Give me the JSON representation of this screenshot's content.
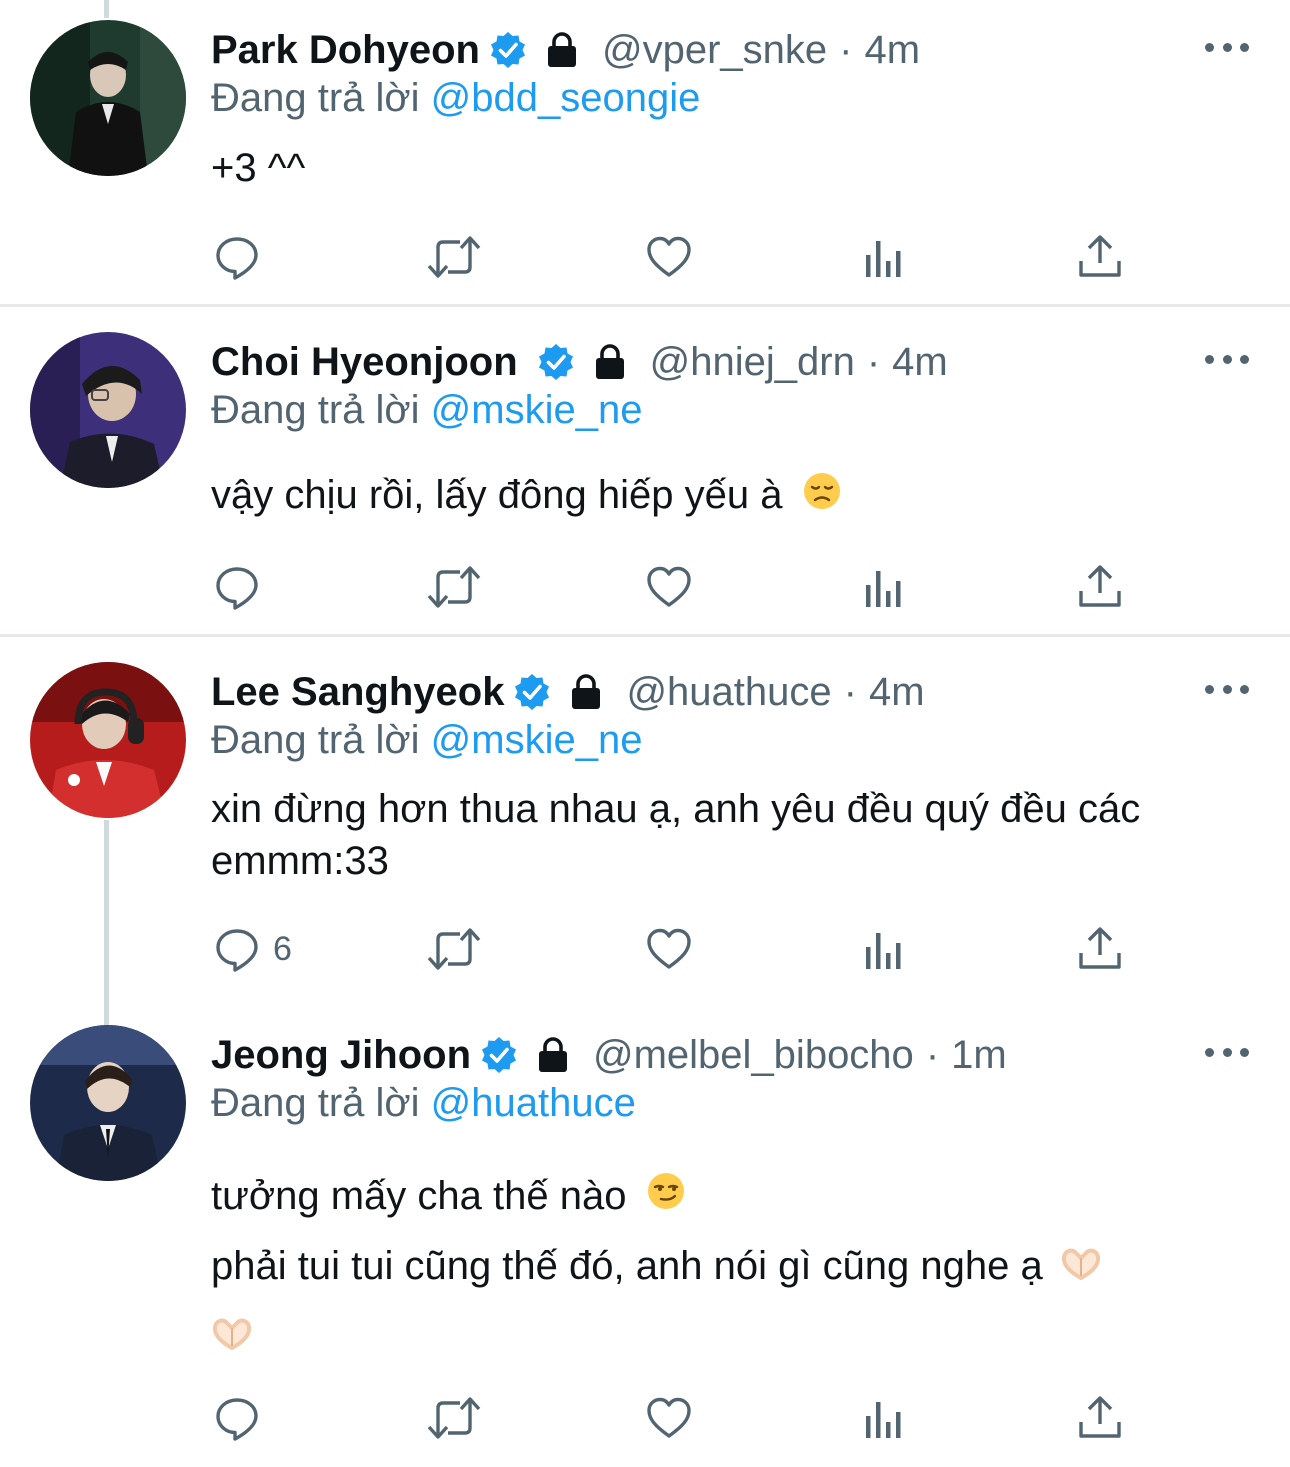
{
  "reply_prefix": "Đang trả lời",
  "colors": {
    "verified": "#1d9bf0",
    "mention": "#1d9bf0",
    "secondary": "#536471",
    "separator": "#e7e9ea"
  },
  "tweets": [
    {
      "name": "Park Dohyeon",
      "handle": "@vper_snke",
      "dot": "·",
      "time": "4m",
      "reply_to": "@bdd_seongie",
      "lines": [
        "+3 ^^"
      ],
      "reply_count": ""
    },
    {
      "name": "Choi Hyeonjoon",
      "handle": "@hniej_drn",
      "dot": "·",
      "time": "4m",
      "reply_to": "@mskie_ne",
      "lines": [
        "vậy chịu rồi, lấy đông hiếp yếu à"
      ],
      "reply_count": ""
    },
    {
      "name": "Lee Sanghyeok",
      "handle": "@huathuce",
      "dot": "·",
      "time": "4m",
      "reply_to": "@mskie_ne",
      "lines": [
        "xin đừng hơn thua nhau ạ, anh yêu đều quý đều các",
        "emmm:33"
      ],
      "reply_count": "6"
    },
    {
      "name": "Jeong Jihoon",
      "handle": "@melbel_bibocho",
      "dot": "·",
      "time": "1m",
      "reply_to": "@huathuce",
      "lines": [
        "tưởng mấy cha thế nào",
        "phải tui tui cũng thế đó, anh nói gì cũng nghe ạ"
      ],
      "reply_count": ""
    }
  ],
  "icons": [
    "verified-badge-icon",
    "lock-icon",
    "more-icon",
    "reply-icon",
    "retweet-icon",
    "like-icon",
    "views-icon",
    "share-icon"
  ]
}
